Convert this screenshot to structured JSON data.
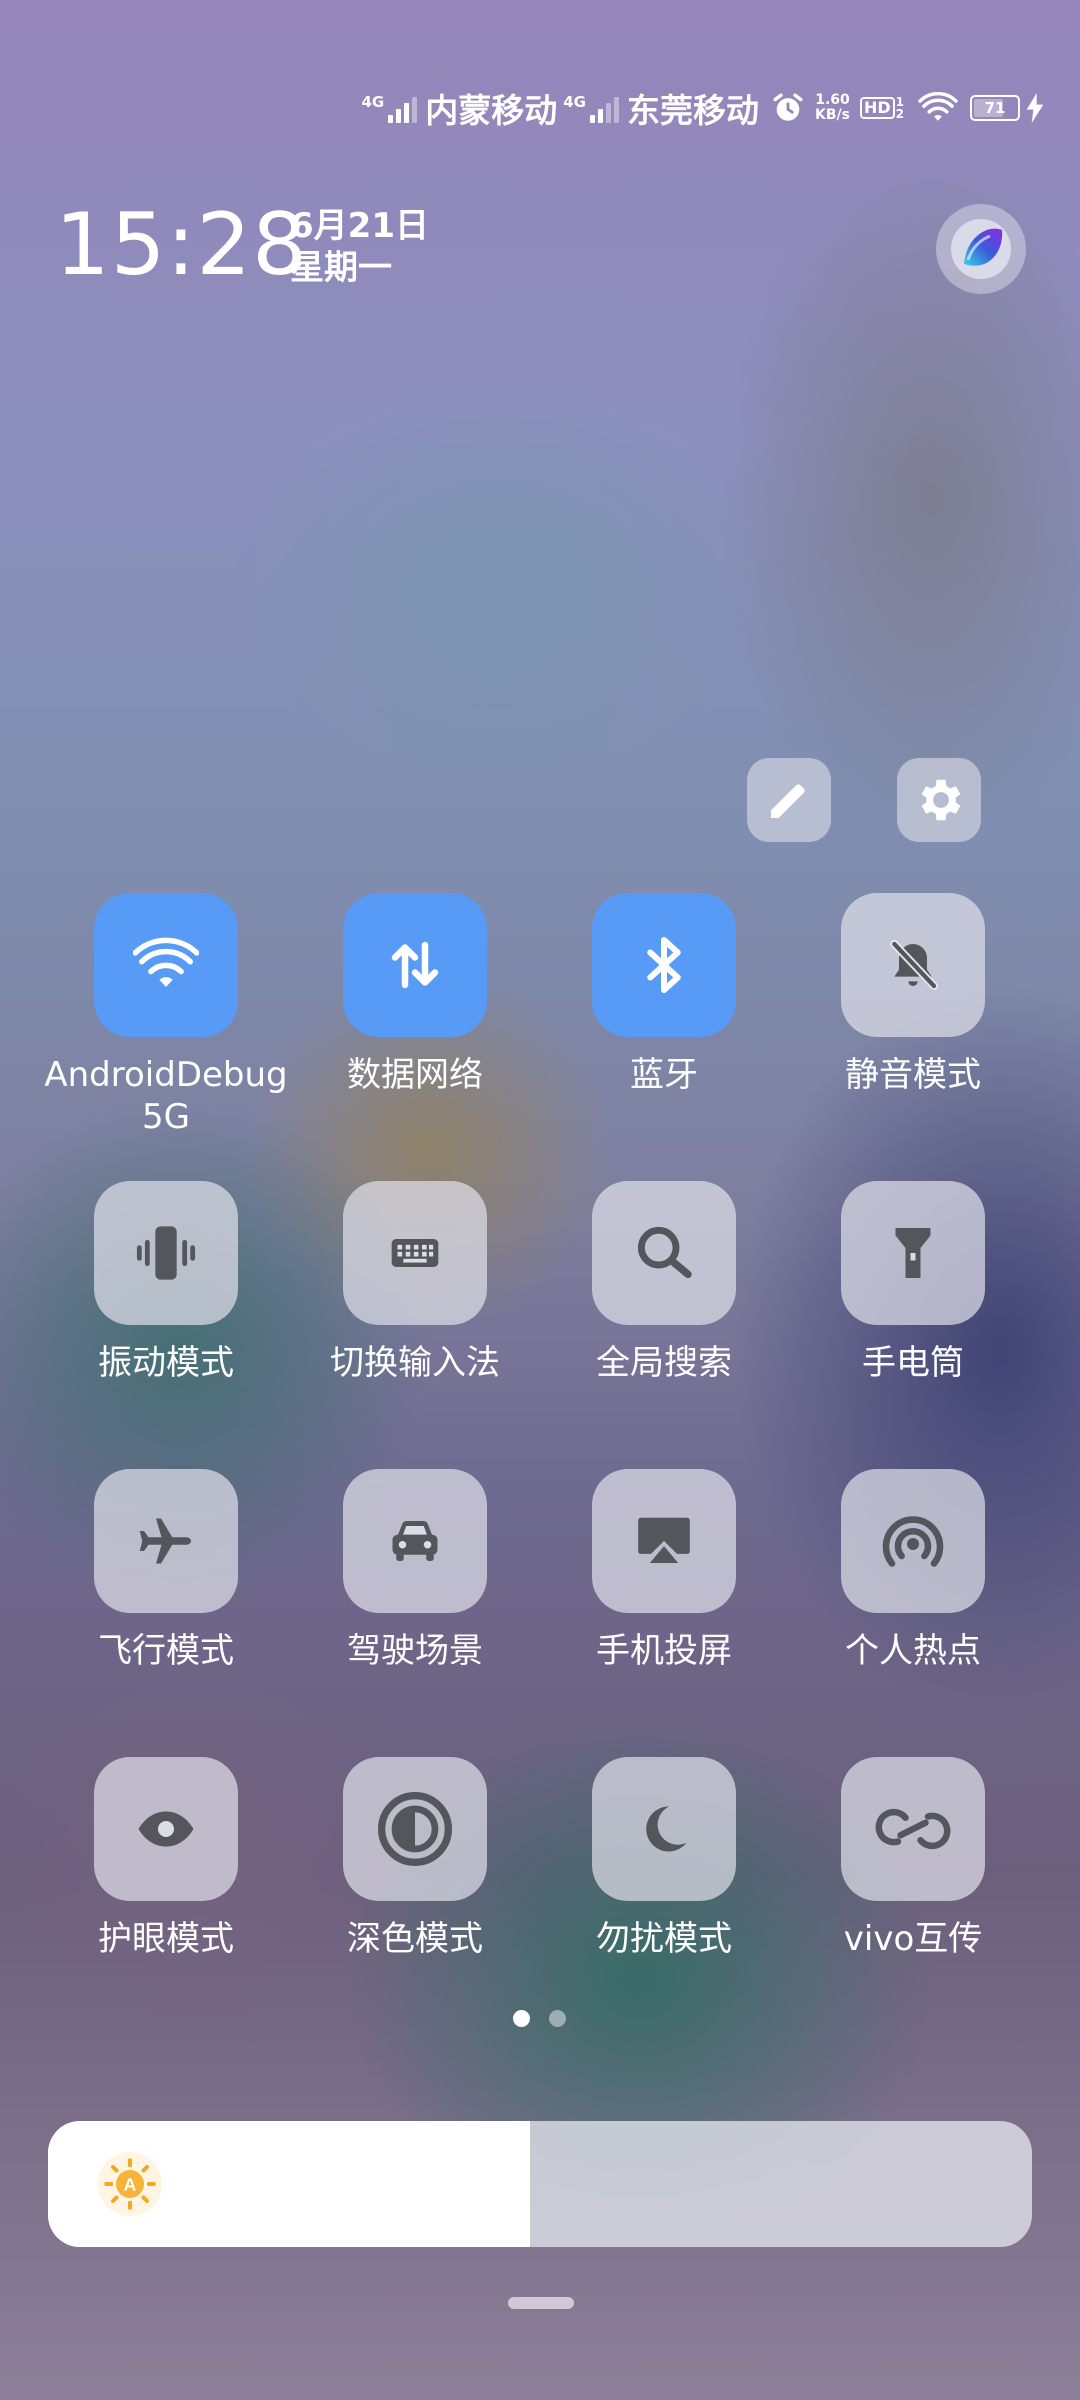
{
  "status_bar": {
    "sim1": {
      "network": "4G",
      "carrier": "内蒙移动",
      "signal_bars": 3
    },
    "sim2": {
      "network": "4G",
      "carrier": "东莞移动",
      "signal_bars": 2
    },
    "alarm_icon": "alarm-clock-icon",
    "net_speed_value": "1.60",
    "net_speed_unit": "KB/s",
    "hd_label": "HD",
    "hd_sub_1": "1",
    "hd_sub_2": "2",
    "wifi_icon": "wifi-icon",
    "battery_level": "71",
    "charging_icon": "bolt-icon"
  },
  "header": {
    "time": "15:28",
    "date": "6月21日",
    "weekday": "星期一",
    "assistant_icon": "jovi-assistant-icon"
  },
  "actions": {
    "edit_icon": "pencil-icon",
    "settings_icon": "gear-icon"
  },
  "tiles": [
    {
      "label": "AndroidDebug",
      "label2": "5G",
      "icon": "wifi-icon",
      "active": true
    },
    {
      "label": "数据网络",
      "icon": "data-arrows-icon",
      "active": true
    },
    {
      "label": "蓝牙",
      "icon": "bluetooth-icon",
      "active": true
    },
    {
      "label": "静音模式",
      "icon": "bell-off-icon",
      "active": false
    },
    {
      "label": "振动模式",
      "icon": "vibrate-icon",
      "active": false
    },
    {
      "label": "切换输入法",
      "icon": "keyboard-icon",
      "active": false
    },
    {
      "label": "全局搜索",
      "icon": "search-icon",
      "active": false
    },
    {
      "label": "手电筒",
      "icon": "flashlight-icon",
      "active": false
    },
    {
      "label": "飞行模式",
      "icon": "airplane-icon",
      "active": false
    },
    {
      "label": "驾驶场景",
      "icon": "car-icon",
      "active": false
    },
    {
      "label": "手机投屏",
      "icon": "cast-screen-icon",
      "active": false
    },
    {
      "label": "个人热点",
      "icon": "hotspot-icon",
      "active": false
    },
    {
      "label": "护眼模式",
      "icon": "eye-icon",
      "active": false
    },
    {
      "label": "深色模式",
      "icon": "dark-mode-icon",
      "active": false
    },
    {
      "label": "勿扰模式",
      "icon": "moon-icon",
      "active": false
    },
    {
      "label": "vivo互传",
      "icon": "share-link-icon",
      "active": false
    }
  ],
  "pager": {
    "pages": 2,
    "current": 1
  },
  "brightness": {
    "level": 0.49,
    "auto_label": "A",
    "icon": "auto-brightness-icon"
  },
  "colors": {
    "accent": "#579bf6",
    "tile_off": "#dcdce6",
    "icon_dark": "#505058"
  }
}
